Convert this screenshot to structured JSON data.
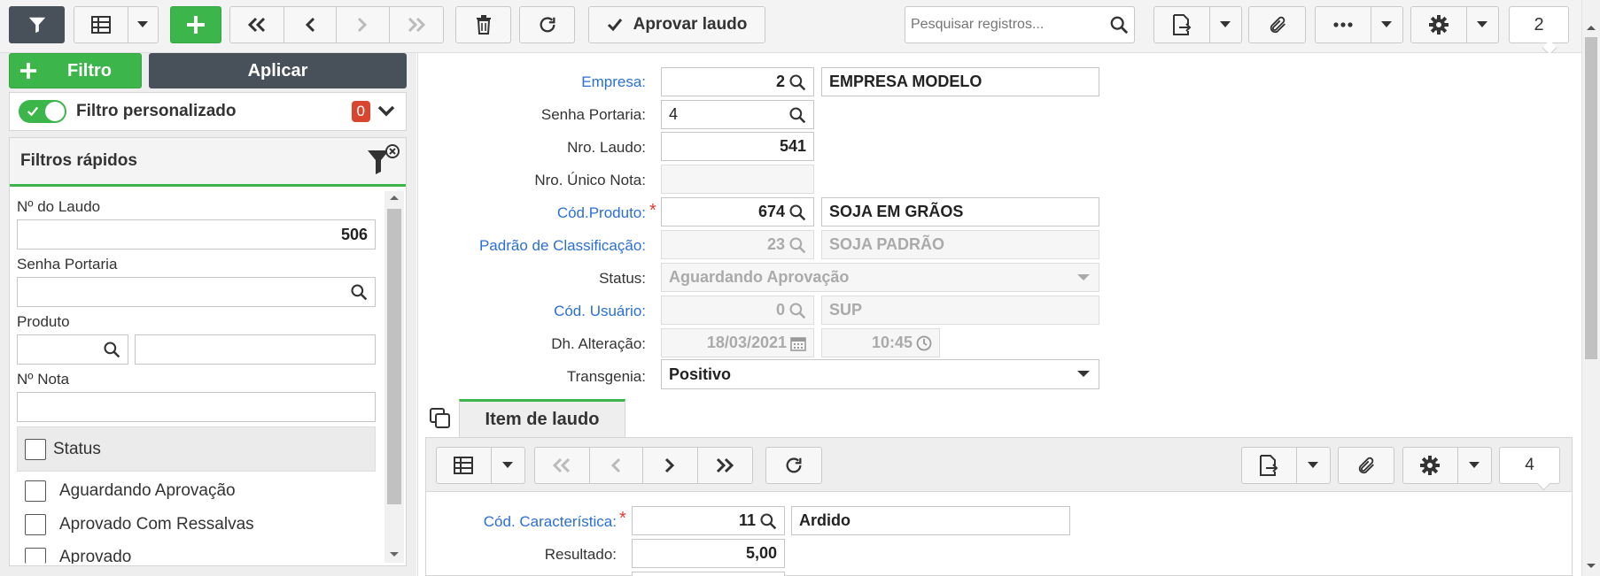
{
  "toolbar": {
    "approve_label": "Aprovar laudo",
    "search_placeholder": "Pesquisar registros...",
    "page_count": "2"
  },
  "sidebar": {
    "add_filter_label": "Filtro",
    "apply_label": "Aplicar",
    "custom_filter_label": "Filtro personalizado",
    "custom_filter_count": "0",
    "quick_filters_title": "Filtros rápidos",
    "fields": {
      "laudo_label": "Nº do Laudo",
      "laudo_value": "506",
      "senha_label": "Senha Portaria",
      "produto_label": "Produto",
      "nota_label": "Nº Nota"
    },
    "status_header": "Status",
    "status_options": [
      "Aguardando Aprovação",
      "Aprovado Com Ressalvas",
      "Aprovado"
    ]
  },
  "form": {
    "empresa": {
      "label": "Empresa:",
      "code": "2",
      "name": "EMPRESA MODELO"
    },
    "senha": {
      "label": "Senha Portaria:",
      "value": "4"
    },
    "nro_laudo": {
      "label": "Nro. Laudo:",
      "value": "541"
    },
    "nro_unico": {
      "label": "Nro. Único Nota:",
      "value": ""
    },
    "produto": {
      "label": "Cód.Produto:",
      "code": "674",
      "name": "SOJA EM GRÃOS"
    },
    "padrao": {
      "label": "Padrão de Classificação:",
      "code": "23",
      "name": "SOJA PADRÃO"
    },
    "status": {
      "label": "Status:",
      "value": "Aguardando Aprovação"
    },
    "usuario": {
      "label": "Cód. Usuário:",
      "code": "0",
      "name": "SUP"
    },
    "alteracao": {
      "label": "Dh. Alteração:",
      "date": "18/03/2021",
      "time": "10:45"
    },
    "transgenia": {
      "label": "Transgenia:",
      "value": "Positivo"
    }
  },
  "detail": {
    "tab_label": "Item de laudo",
    "page_count": "4",
    "caracteristica": {
      "label": "Cód. Característica:",
      "code": "11",
      "name": "Ardido"
    },
    "resultado": {
      "label": "Resultado:",
      "value": "5,00"
    }
  },
  "colors": {
    "accent_green": "#3cb64a",
    "dark_button": "#48505a",
    "link_blue": "#2a6fd6",
    "badge_red": "#d9452f"
  }
}
